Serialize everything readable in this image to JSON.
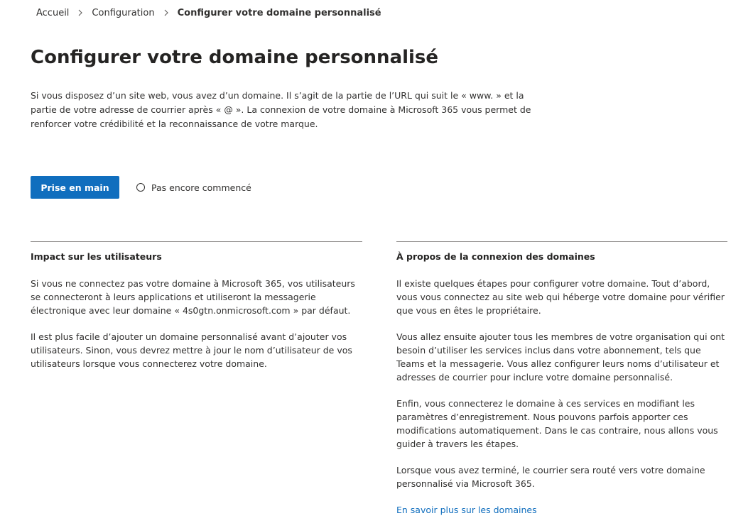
{
  "breadcrumb": {
    "items": [
      "Accueil",
      "Configuration",
      "Configurer votre domaine personnalisé"
    ]
  },
  "page": {
    "title": "Configurer votre domaine personnalisé",
    "intro": "Si vous disposez d’un site web, vous avez d’un domaine. Il s’agit de la partie de l’URL qui suit le « www. » et la partie de votre adresse de courrier après « @ ». La connexion de votre domaine à Microsoft 365 vous permet de renforcer votre crédibilité et la reconnaissance de votre marque."
  },
  "actions": {
    "primary_label": "Prise en main",
    "status_label": "Pas encore commencé"
  },
  "impact": {
    "heading": "Impact sur les utilisateurs",
    "paragraphs": [
      "Si vous ne connectez pas votre domaine à Microsoft 365, vos utilisateurs se connecteront à leurs applications et utiliseront la messagerie électronique avec leur domaine « 4s0gtn.onmicrosoft.com » par défaut.",
      "Il est plus facile d’ajouter un domaine personnalisé avant d’ajouter vos utilisateurs. Sinon, vous devrez mettre à jour le nom d’utilisateur de vos utilisateurs lorsque vous connecterez votre domaine."
    ]
  },
  "about": {
    "heading": "À propos de la connexion des domaines",
    "paragraphs": [
      "Il existe quelques étapes pour configurer votre domaine. Tout d’abord, vous vous connectez au site web qui héberge votre domaine pour vérifier que vous en êtes le propriétaire.",
      "Vous allez ensuite ajouter tous les membres de votre organisation qui ont besoin d’utiliser les services inclus dans votre abonnement, tels que Teams et la messagerie. Vous allez configurer leurs noms d’utilisateur et adresses de courrier pour inclure votre domaine personnalisé.",
      "Enfin, vous connecterez le domaine à ces services en modifiant les paramètres d’enregistrement. Nous pouvons parfois apporter ces modifications automatiquement. Dans le cas contraire, nous allons vous guider à travers les étapes.",
      "Lorsque vous avez terminé, le courrier sera routé vers votre domaine personnalisé via Microsoft 365."
    ],
    "link_label": "En savoir plus sur les domaines"
  }
}
